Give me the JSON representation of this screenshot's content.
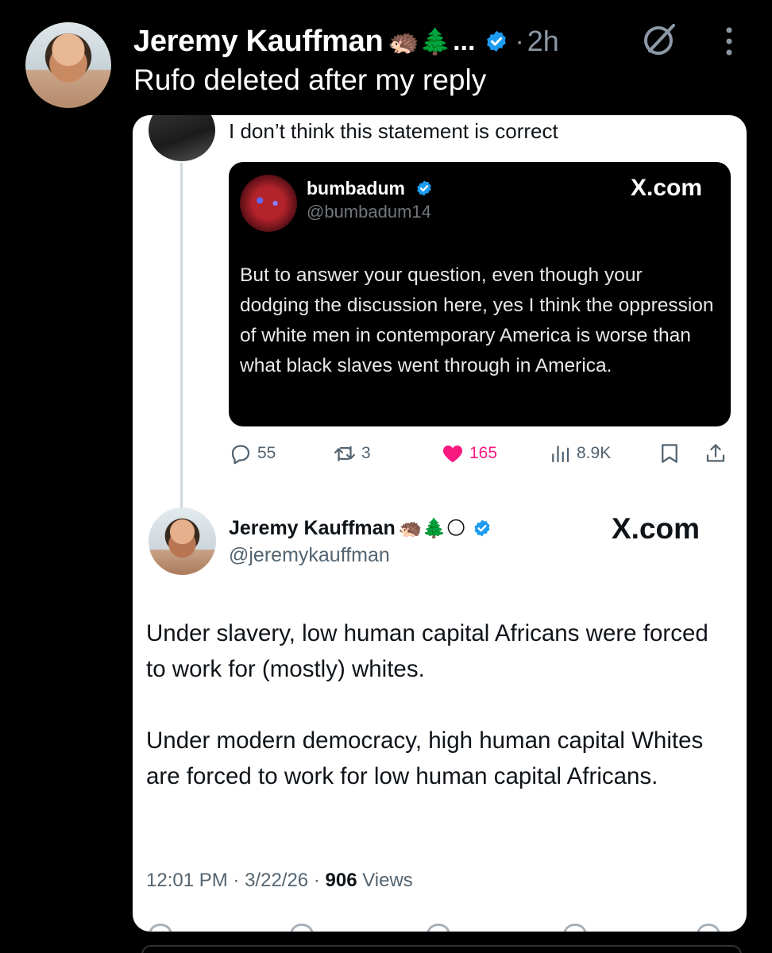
{
  "post": {
    "author": "Jeremy Kauffman",
    "author_emoji": "🦔🌲",
    "ellipsis": "...",
    "dot": "·",
    "time": "2h",
    "text": "Rufo deleted after my reply"
  },
  "card": {
    "reply_text": "I don’t think this statement is correct",
    "quote": {
      "name": "bumbadum",
      "handle": "@bumbadum14",
      "site": "X.com",
      "body": "But to answer your question, even though your dodging the discussion here, yes I think the oppression of white men in contemporary America is worse than what black slaves went through in America."
    },
    "actions": {
      "replies": "55",
      "reposts": "3",
      "likes": "165",
      "views": "8.9K"
    },
    "quoted_tweet": {
      "name": "Jeremy Kauffman",
      "name_emoji": "🦔🌲🌕",
      "handle": "@jeremykauffman",
      "site": "X.com",
      "paragraphs": [
        "Under slavery, low human capital Africans were forced to work for (mostly) whites.",
        "Under modern democracy, high human capital Whites are forced to work for low human capital Africans."
      ],
      "time": "12:01 PM",
      "sep1": "·",
      "date": "3/22/26",
      "sep2": "·",
      "view_count": "906",
      "view_label": "Views"
    }
  },
  "colors": {
    "background": "#000000",
    "verified_blue": "#1d9bf0",
    "like_pink": "#f91880",
    "secondary_text": "#536471"
  },
  "icons": [
    "verified-icon",
    "grok-icon",
    "more-icon",
    "reply-icon",
    "repost-icon",
    "like-icon",
    "views-icon",
    "bookmark-icon",
    "share-icon"
  ]
}
